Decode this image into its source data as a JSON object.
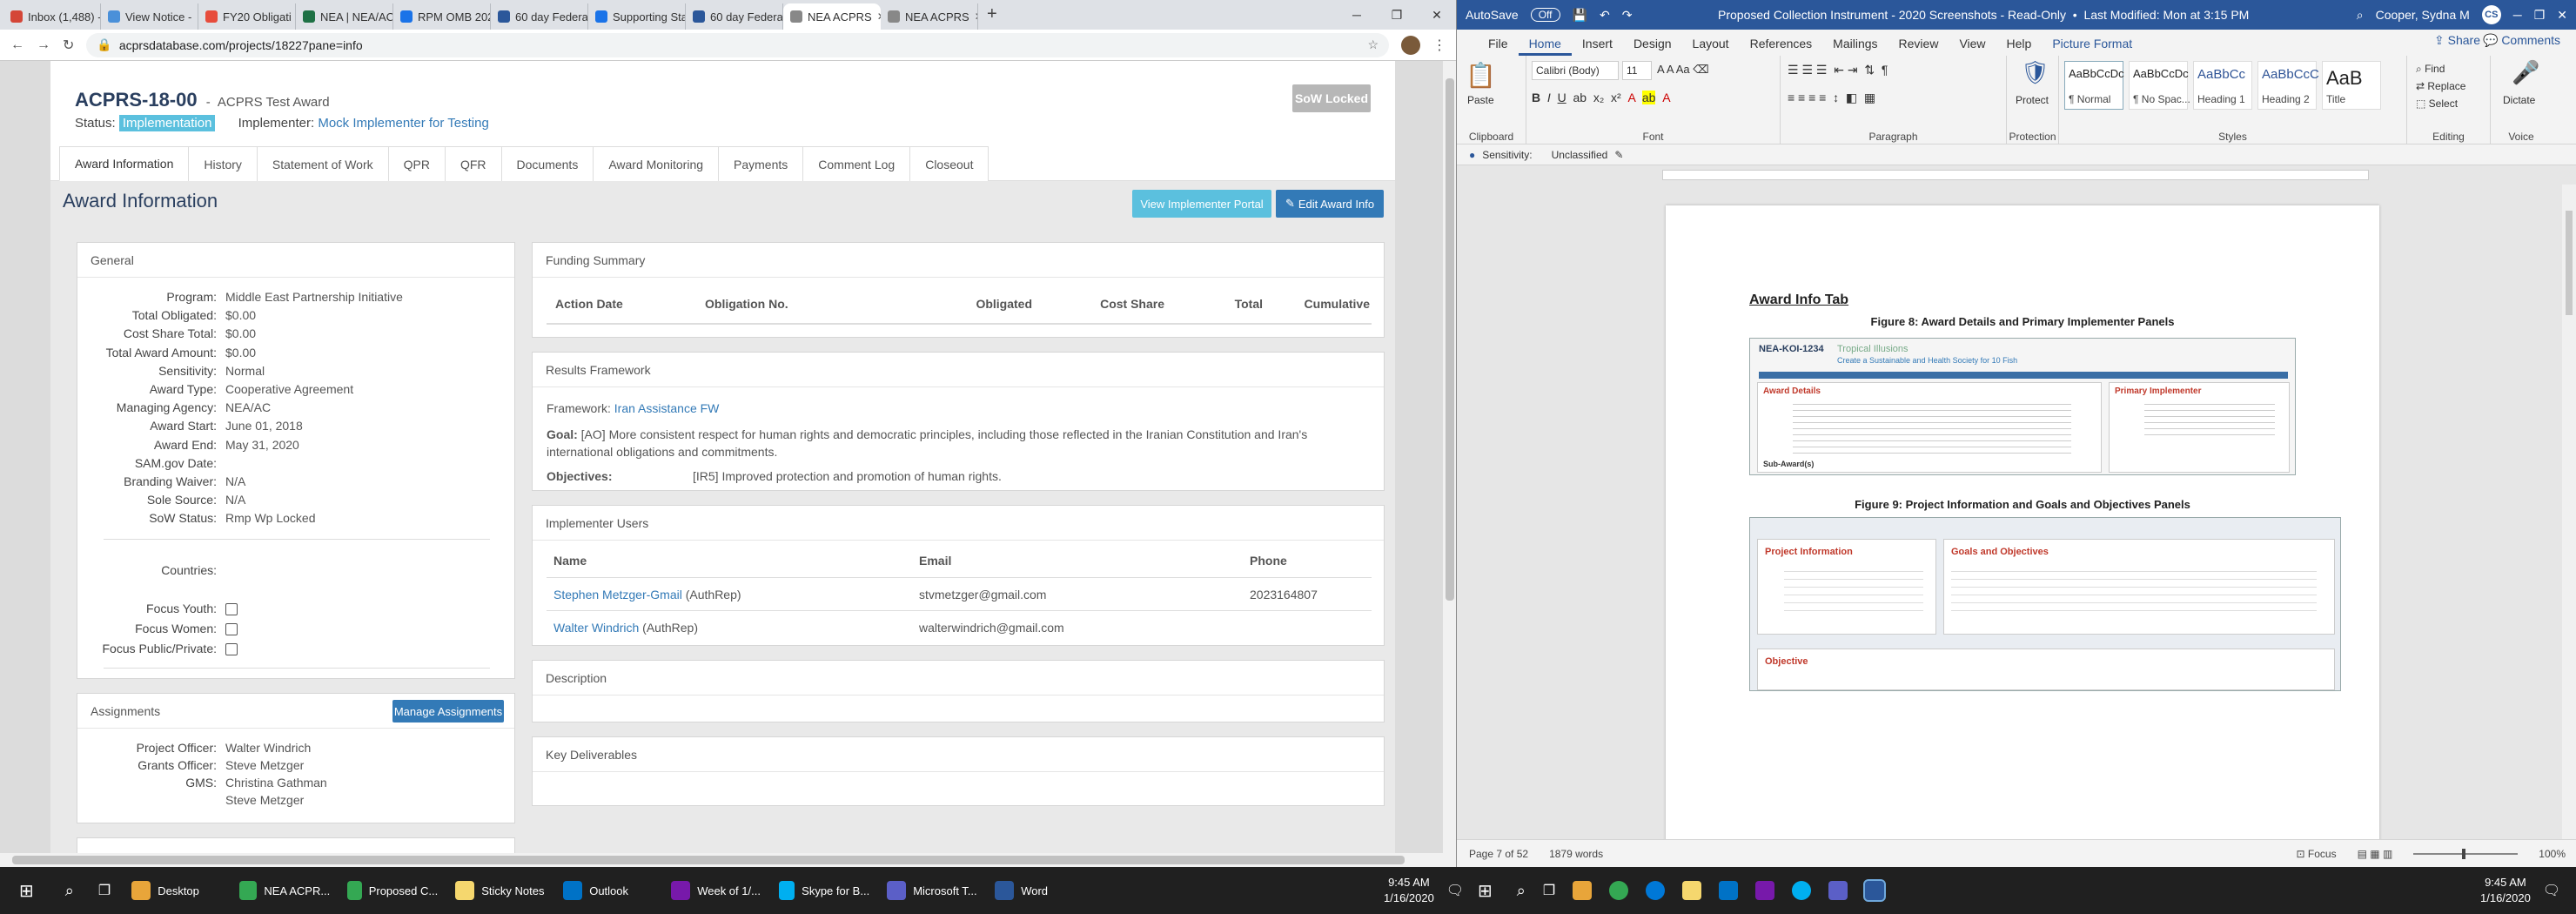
{
  "browser": {
    "tabs": [
      {
        "label": "Inbox (1,488) -",
        "color": "#d44638"
      },
      {
        "label": "View Notice -",
        "color": "#4a90d9"
      },
      {
        "label": "FY20 Obligati",
        "color": "#e74c3c"
      },
      {
        "label": "NEA | NEA/AC",
        "color": "#1e7145"
      },
      {
        "label": "RPM OMB 202",
        "color": "#1a73e8"
      },
      {
        "label": "60 day Federal",
        "color": "#2b579a"
      },
      {
        "label": "Supporting Sta",
        "color": "#1a73e8"
      },
      {
        "label": "60 day Federal",
        "color": "#2b579a"
      },
      {
        "label": "NEA ACPRS",
        "color": "#888888"
      },
      {
        "label": "NEA ACPRS",
        "color": "#888888"
      }
    ],
    "url": "acprsdatabase.com/projects/18227pane=info"
  },
  "award": {
    "id": "ACPRS-18-00",
    "name": "ACPRS Test Award",
    "status_label": "Status:",
    "status": "Implementation",
    "implementer_label": "Implementer:",
    "implementer": "Mock Implementer for Testing",
    "sow_locked": "SoW Locked"
  },
  "nav_tabs": [
    "Award Information",
    "History",
    "Statement of Work",
    "QPR",
    "QFR",
    "Documents",
    "Award Monitoring",
    "Payments",
    "Comment Log",
    "Closeout"
  ],
  "panel": {
    "title": "Award Information",
    "view_implementer_btn": "View Implementer Portal",
    "edit_btn": "Edit Award Info"
  },
  "general": {
    "title": "General",
    "fields": [
      {
        "k": "Program:",
        "v": "Middle East Partnership Initiative",
        "link": false
      },
      {
        "k": "Total Obligated:",
        "v": "$0.00",
        "link": false
      },
      {
        "k": "Cost Share Total:",
        "v": "$0.00",
        "link": false
      },
      {
        "k": "Total Award Amount:",
        "v": "$0.00",
        "link": false
      },
      {
        "k": "Sensitivity:",
        "v": "Normal",
        "link": false
      },
      {
        "k": "Award Type:",
        "v": "Cooperative Agreement",
        "link": false
      },
      {
        "k": "Managing Agency:",
        "v": "NEA/AC",
        "link": true
      },
      {
        "k": "Award Start:",
        "v": "June 01, 2018",
        "link": false
      },
      {
        "k": "Award End:",
        "v": "May 31, 2020",
        "link": false
      },
      {
        "k": "SAM.gov Date:",
        "v": "",
        "link": false
      },
      {
        "k": "Branding Waiver:",
        "v": "N/A",
        "link": false
      },
      {
        "k": "Sole Source:",
        "v": "N/A",
        "link": false
      },
      {
        "k": "SoW Status:",
        "v": "Rmp Wp Locked",
        "link": false
      }
    ],
    "countries_label": "Countries:",
    "focus": [
      "Focus Youth:",
      "Focus Women:",
      "Focus Public/Private:"
    ]
  },
  "assignments": {
    "title": "Assignments",
    "manage_btn": "Manage Assignments",
    "project_officer_label": "Project Officer:",
    "project_officer": "Walter Windrich",
    "grants_officer_label": "Grants Officer:",
    "grants_officer": "Steve Metzger",
    "gms_label": "GMS:",
    "gms": [
      "Christina Gathman",
      "Steve Metzger"
    ]
  },
  "funding": {
    "title": "Funding Summary",
    "columns": [
      "Action Date",
      "Obligation No.",
      "Obligated",
      "Cost Share",
      "Total",
      "Cumulative"
    ]
  },
  "results": {
    "title": "Results Framework",
    "framework_label": "Framework:",
    "framework": "Iran Assistance FW",
    "goal_label": "Goal:",
    "goal": "[AO] More consistent respect for human rights and democratic principles, including those reflected in the Iranian Constitution and Iran's international obligations and commitments.",
    "objectives_label": "Objectives:",
    "objectives": "[IR5] Improved protection and promotion of human rights."
  },
  "users": {
    "title": "Implementer Users",
    "columns": [
      "Name",
      "Email",
      "Phone"
    ],
    "rows": [
      {
        "name": "Stephen Metzger-Gmail",
        "role": "(AuthRep)",
        "email": "stvmetzger@gmail.com",
        "phone": "2023164807"
      },
      {
        "name": "Walter Windrich",
        "role": "(AuthRep)",
        "email": "walterwindrich@gmail.com",
        "phone": ""
      }
    ]
  },
  "description": {
    "title": "Description"
  },
  "deliverables": {
    "title": "Key Deliverables"
  },
  "word": {
    "autosave": "AutoSave",
    "autosave_state": "Off",
    "title": "Proposed Collection Instrument - 2020 Screenshots - Read-Only",
    "modified": "Last Modified: Mon at 3:15 PM",
    "user": "Cooper, Sydna M",
    "initials": "CS",
    "menu": [
      "File",
      "Home",
      "Insert",
      "Design",
      "Layout",
      "References",
      "Mailings",
      "Review",
      "View",
      "Help",
      "Picture Format"
    ],
    "share": "Share",
    "comments": "Comments",
    "ribbon": {
      "paste": "Paste",
      "clipboard": "Clipboard",
      "font_name": "Calibri (Body)",
      "font_size": "11",
      "font": "Font",
      "paragraph": "Paragraph",
      "protect": "Protect",
      "protection": "Protection",
      "styles": [
        {
          "preview": "AaBbCcDc",
          "name": "¶ Normal"
        },
        {
          "preview": "AaBbCcDc",
          "name": "¶ No Spac..."
        },
        {
          "preview": "AaBbCc",
          "name": "Heading 1"
        },
        {
          "preview": "AaBbCcC",
          "name": "Heading 2"
        },
        {
          "preview": "AaB",
          "name": "Title"
        }
      ],
      "styles_label": "Styles",
      "find": "Find",
      "replace": "Replace",
      "select": "Select",
      "editing": "Editing",
      "dictate": "Dictate",
      "voice": "Voice"
    },
    "sensitivity_label": "Sensitivity:",
    "sensitivity": "Unclassified",
    "doc": {
      "heading": "Award Info Tab",
      "fig8": "Figure 8: Award Details and Primary Implementer Panels",
      "fig9": "Figure 9: Project Information and Goals and Objectives Panels",
      "mini_award_id": "NEA-KOI-1234",
      "mini_award_name": "Tropical Illusions",
      "mini_award_sub": "Create a Sustainable and Health Society for 10 Fish",
      "mini_award_details": "Award Details",
      "mini_primary_impl": "Primary Implementer",
      "mini_subawards": "Sub-Award(s)",
      "mini_project_info": "Project Information",
      "mini_goals": "Goals and Objectives",
      "mini_objective": "Objective"
    },
    "status": {
      "page": "Page 7 of 52",
      "words": "1879 words",
      "focus": "Focus",
      "zoom": "100%"
    }
  },
  "taskbar": {
    "items": [
      {
        "label": "Desktop",
        "color": "#e8a53a"
      },
      {
        "label": "NEA ACPR...",
        "color": "#34a853"
      },
      {
        "label": "Proposed C...",
        "color": "#34a853"
      },
      {
        "label": "Sticky Notes",
        "color": "#f5d76e"
      },
      {
        "label": "Outlook",
        "color": "#0072c6"
      },
      {
        "label": "Week of 1/...",
        "color": "#7719aa"
      },
      {
        "label": "Skype for B...",
        "color": "#00aff0"
      },
      {
        "label": "Microsoft T...",
        "color": "#5b5fc7"
      },
      {
        "label": "Word",
        "color": "#2b579a"
      }
    ],
    "time": "9:45 AM",
    "date": "1/16/2020"
  }
}
